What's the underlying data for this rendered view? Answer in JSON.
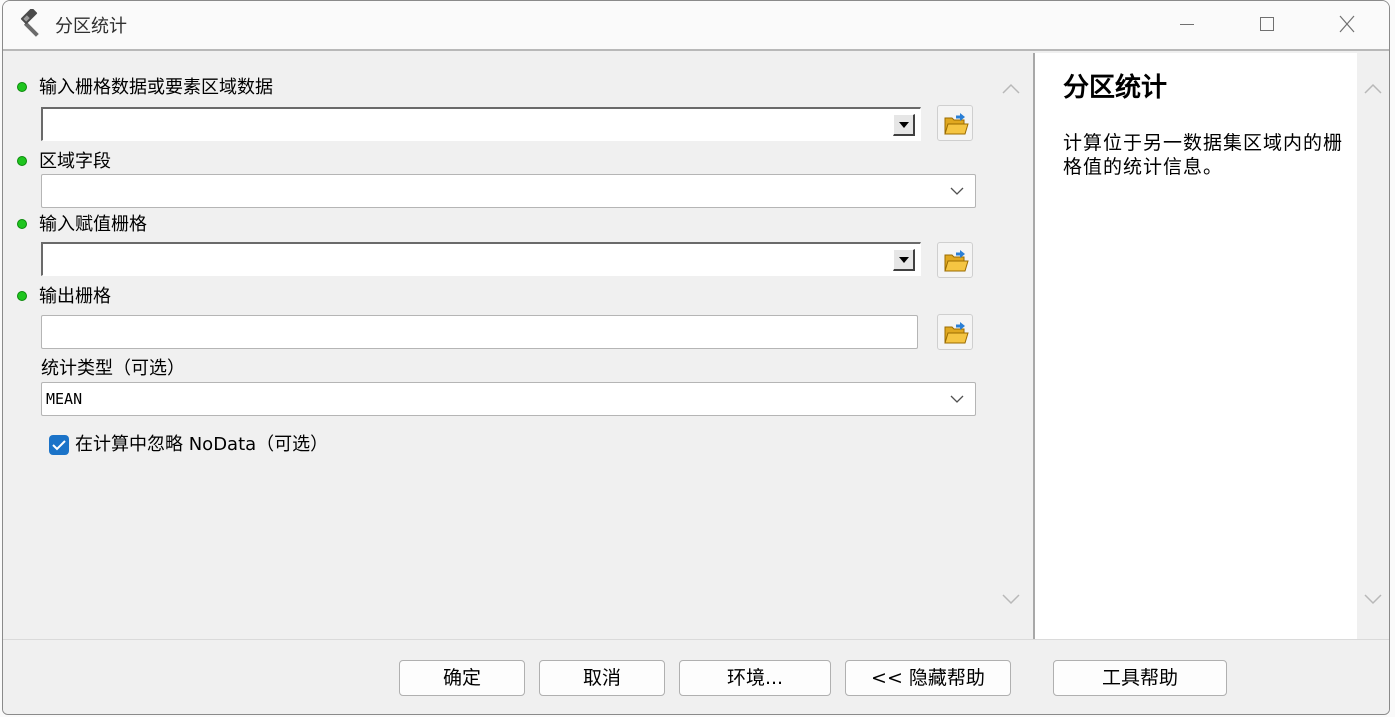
{
  "window": {
    "title": "分区统计"
  },
  "parameters": {
    "in_zone": {
      "label": "输入栅格数据或要素区域数据",
      "value": ""
    },
    "zone_field": {
      "label": "区域字段",
      "value": ""
    },
    "in_value_raster": {
      "label": "输入赋值栅格",
      "value": ""
    },
    "out_raster": {
      "label": "输出栅格",
      "value": ""
    },
    "statistics_type": {
      "label": "统计类型（可选）",
      "value": "MEAN"
    },
    "ignore_nodata": {
      "label": "在计算中忽略 NoData（可选）",
      "checked": true
    }
  },
  "help": {
    "title": "分区统计",
    "description": "计算位于另一数据集区域内的栅格值的统计信息。"
  },
  "buttons": {
    "ok": "确定",
    "cancel": "取消",
    "environments": "环境...",
    "hide_help": "<< 隐藏帮助",
    "tool_help": "工具帮助"
  },
  "colors": {
    "required_bullet": "#1fc51f",
    "checkbox": "#1b73c8",
    "folder": "#f5c542"
  },
  "icons": {
    "app": "hammer-icon",
    "browse": "open-folder-icon"
  }
}
